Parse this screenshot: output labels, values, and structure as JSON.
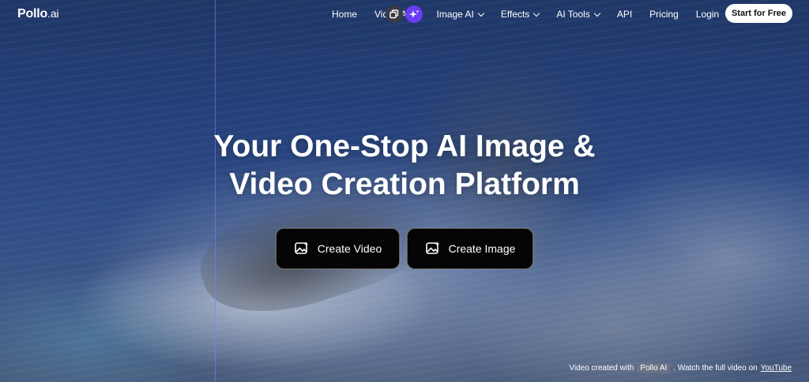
{
  "brand": {
    "name": "Pollo",
    "suffix": ".ai"
  },
  "nav": {
    "items": [
      {
        "label": "Home",
        "has_dropdown": false
      },
      {
        "label": "Video AI",
        "has_dropdown": true
      },
      {
        "label": "Image AI",
        "has_dropdown": true
      },
      {
        "label": "Effects",
        "has_dropdown": true
      },
      {
        "label": "AI Tools",
        "has_dropdown": true
      },
      {
        "label": "API",
        "has_dropdown": false
      },
      {
        "label": "Pricing",
        "has_dropdown": false
      },
      {
        "label": "Login",
        "has_dropdown": false
      }
    ],
    "cta_label": "Start for Free"
  },
  "hero": {
    "headline_line1": "Your One-Stop AI Image &",
    "headline_line2": "Video Creation Platform",
    "create_video_label": "Create Video",
    "create_image_label": "Create Image"
  },
  "credit": {
    "prefix": "Video created with",
    "tag": "Pollo AI",
    "middle": ". Watch the full video on",
    "link": "YouTube"
  },
  "icons": {
    "copy": "copy-icon",
    "sparkle": "sparkle-icon",
    "image_spark": "image-sparkle-icon",
    "chevron": "chevron-down-icon"
  },
  "colors": {
    "accent_purple": "#6a3df5",
    "cta_bg": "#050507",
    "nav_button_bg": "#ffffff"
  }
}
